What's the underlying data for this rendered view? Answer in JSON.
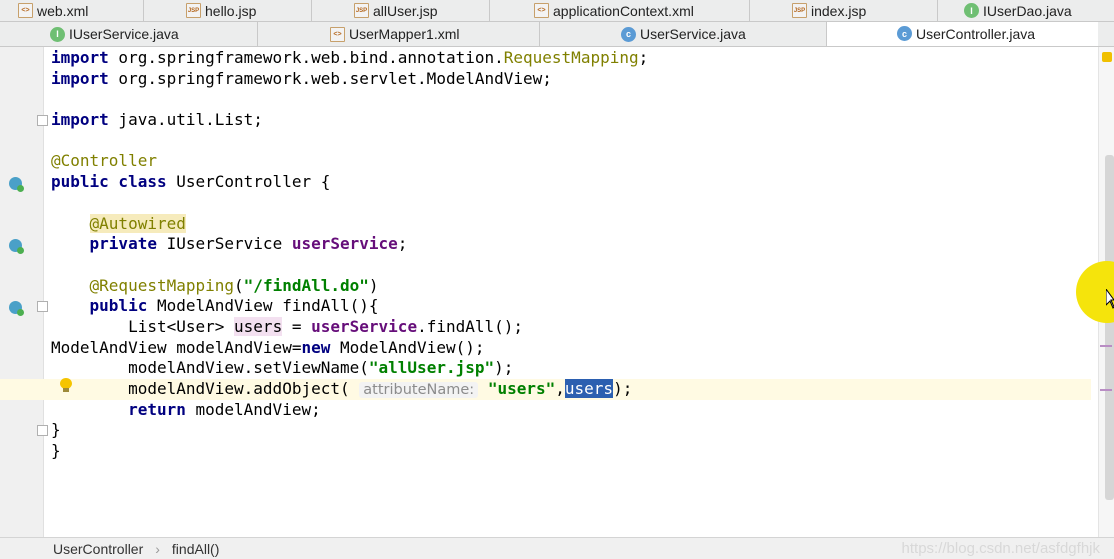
{
  "tabs_row1": [
    {
      "label": "web.xml",
      "type": "xml"
    },
    {
      "label": "hello.jsp",
      "type": "jsp"
    },
    {
      "label": "allUser.jsp",
      "type": "jsp"
    },
    {
      "label": "applicationContext.xml",
      "type": "xml"
    },
    {
      "label": "index.jsp",
      "type": "jsp"
    },
    {
      "label": "IUserDao.java",
      "type": "interface"
    }
  ],
  "tabs_row2": [
    {
      "label": "IUserService.java",
      "type": "interface"
    },
    {
      "label": "UserMapper1.xml",
      "type": "xml"
    },
    {
      "label": "UserService.java",
      "type": "class"
    },
    {
      "label": "UserController.java",
      "type": "class",
      "active": true
    }
  ],
  "code": {
    "l1_kw": "import",
    "l1_pkg": " org.springframework.web.bind.annotation.",
    "l1_ann": "RequestMapping",
    "l1_end": ";",
    "l2_kw": "import",
    "l2_rest": " org.springframework.web.servlet.ModelAndView;",
    "l4_kw": "import",
    "l4_rest": " java.util.List;",
    "l6_ann": "@Controller",
    "l7_kw": "public class",
    "l7_rest": " UserController {",
    "l9_ann": "@Autowired",
    "l10_kw": "private",
    "l10_type": " IUserService ",
    "l10_field": "userService",
    "l10_end": ";",
    "l12_ann": "@RequestMapping",
    "l12_open": "(",
    "l12_str": "\"/findAll.do\"",
    "l12_close": ")",
    "l13_kw": "public",
    "l13_rest": " ModelAndView findAll(){",
    "l14_type": "List<User> ",
    "l14_var": "users",
    "l14_eq": " = ",
    "l14_field": "userService",
    "l14_end": ".findAll();",
    "l15_a": "ModelAndView modelAndView=",
    "l15_kw": "new",
    "l15_b": " ModelAndView();",
    "l16_a": "modelAndView.setViewName(",
    "l16_str": "\"allUser.jsp\"",
    "l16_end": ");",
    "l17_a": "modelAndView.addObject( ",
    "l17_hint": "attributeName:",
    "l17_sp": " ",
    "l17_str": "\"users\"",
    "l17_comma": ",",
    "l17_sel": "users",
    "l17_end": ");",
    "l18_kw": "return",
    "l18_rest": " modelAndView;",
    "l19": "}",
    "l20": "}"
  },
  "status": {
    "class": "UserController",
    "method": "findAll()",
    "separator": "›"
  },
  "watermark": "https://blog.csdn.net/asfdgfhjk",
  "colors": {
    "keyword": "#000080",
    "annotation": "#808000",
    "string": "#008000",
    "field": "#660e7a",
    "selection": "#2b5fb0"
  }
}
